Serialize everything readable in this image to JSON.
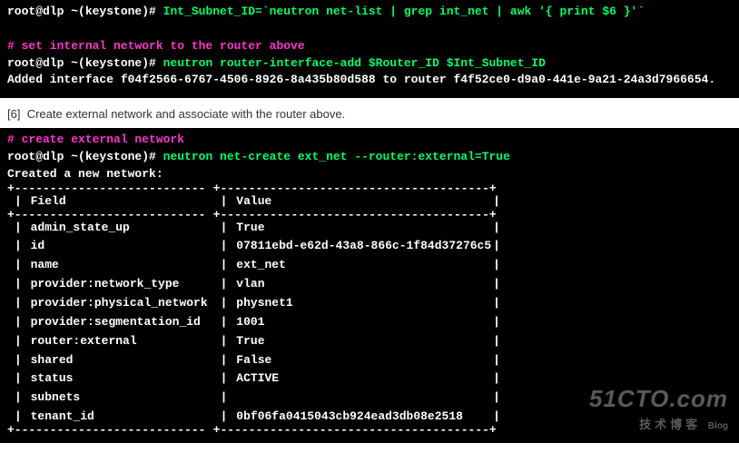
{
  "block1": {
    "prompt1": "root@dlp ~(keystone)#",
    "cmd1": "Int_Subnet_ID=`neutron net-list | grep int_net | awk '{ print $6 }'`",
    "comment": "# set internal network to the router above",
    "prompt2": "root@dlp ~(keystone)#",
    "cmd2": "neutron router-interface-add $Router_ID $Int_Subnet_ID",
    "output": "Added interface f04f2566-6767-4506-8926-8a435b80d588 to router f4f52ce0-d9a0-441e-9a21-24a3d7966654."
  },
  "step": {
    "num": "[6]",
    "text": "Create external network and associate with the router above."
  },
  "block2": {
    "comment": "# create external network",
    "prompt": "root@dlp ~(keystone)#",
    "cmd": "neutron net-create ext_net --router:external=True",
    "output": "Created a new network:",
    "header_field": "Field",
    "header_value": "Value",
    "rows": [
      {
        "field": "admin_state_up",
        "value": "True"
      },
      {
        "field": "id",
        "value": "07811ebd-e62d-43a8-866c-1f84d37276c5"
      },
      {
        "field": "name",
        "value": "ext_net"
      },
      {
        "field": "provider:network_type",
        "value": "vlan"
      },
      {
        "field": "provider:physical_network",
        "value": "physnet1"
      },
      {
        "field": "provider:segmentation_id",
        "value": "1001"
      },
      {
        "field": "router:external",
        "value": "True"
      },
      {
        "field": "shared",
        "value": "False"
      },
      {
        "field": "status",
        "value": "ACTIVE"
      },
      {
        "field": "subnets",
        "value": ""
      },
      {
        "field": "tenant_id",
        "value": "0bf06fa0415043cb924ead3db08e2518"
      }
    ],
    "sep_left": "+---------------------------",
    "sep_right": "+--------------------------------------+",
    "sep_left_pad": "                           ",
    "sep_right_pad": "                                      "
  },
  "watermark": {
    "big": "51CTO.com",
    "small": "技术博客",
    "blog": "Blog"
  }
}
